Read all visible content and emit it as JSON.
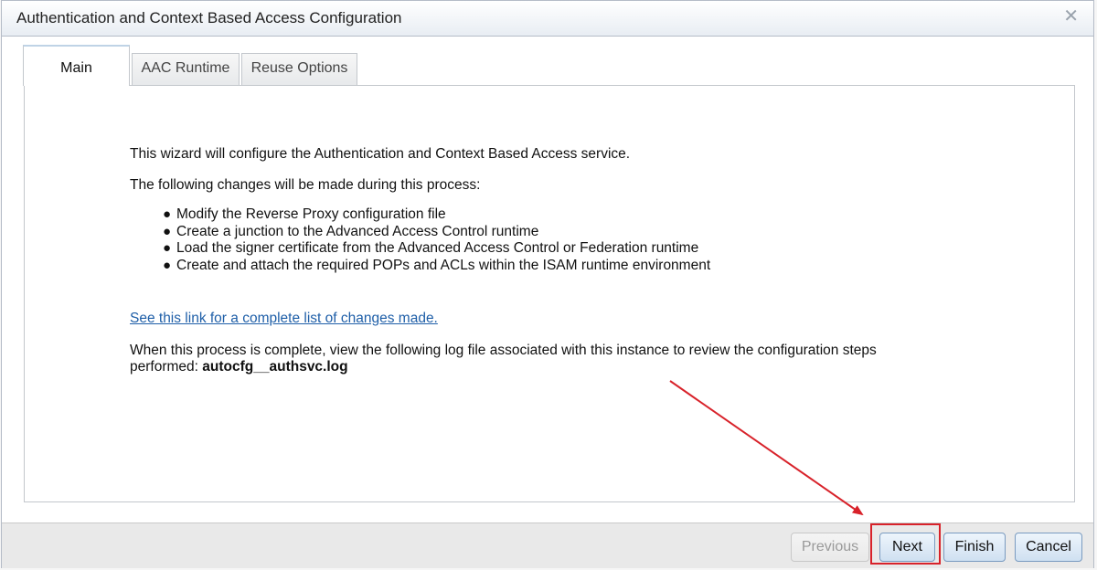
{
  "dialog": {
    "title": "Authentication and Context Based Access Configuration",
    "close_glyph": "✕"
  },
  "tabs": [
    {
      "label": "Main",
      "active": true
    },
    {
      "label": "AAC Runtime",
      "active": false
    },
    {
      "label": "Reuse Options",
      "active": false
    }
  ],
  "main": {
    "intro": "This wizard will configure the Authentication and Context Based Access service.",
    "following": "The following changes will be made during this process:",
    "changes": [
      "Modify the Reverse Proxy configuration file",
      "Create a junction to the Advanced Access Control runtime",
      "Load the signer certificate from the Advanced Access Control or Federation runtime",
      "Create and attach the required POPs and ACLs within the ISAM runtime environment"
    ],
    "link_text": "See this link for a complete list of changes made.",
    "log_line1": "When this process is complete, view the following log file associated with this instance to review the configuration steps",
    "log_prefix": "performed: ",
    "log_file": "autocfg__authsvc.log"
  },
  "footer": {
    "previous_label": "Previous",
    "next_label": "Next",
    "finish_label": "Finish",
    "cancel_label": "Cancel"
  },
  "annotation": {
    "color": "#d8222a"
  },
  "colors": {
    "link": "#1f5fa8",
    "button_border": "#7a9bc0",
    "tab_border": "#c3c7cc"
  }
}
